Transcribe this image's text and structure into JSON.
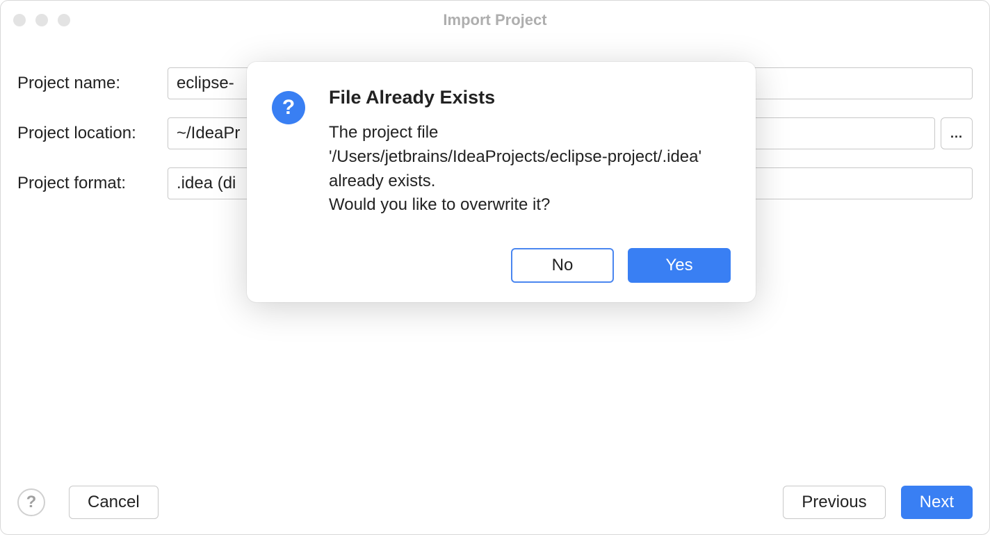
{
  "window": {
    "title": "Import Project"
  },
  "form": {
    "name_label": "Project name:",
    "name_value": "eclipse-",
    "location_label": "Project location:",
    "location_value": "~/IdeaPr",
    "browse_label": "...",
    "format_label": "Project format:",
    "format_value": ".idea (di"
  },
  "footer": {
    "help_glyph": "?",
    "cancel": "Cancel",
    "previous": "Previous",
    "next": "Next"
  },
  "modal": {
    "icon_glyph": "?",
    "title": "File Already Exists",
    "message": "The project file\n'/Users/jetbrains/IdeaProjects/eclipse-project/.idea'\nalready exists.\nWould you like to overwrite it?",
    "no": "No",
    "yes": "Yes"
  }
}
